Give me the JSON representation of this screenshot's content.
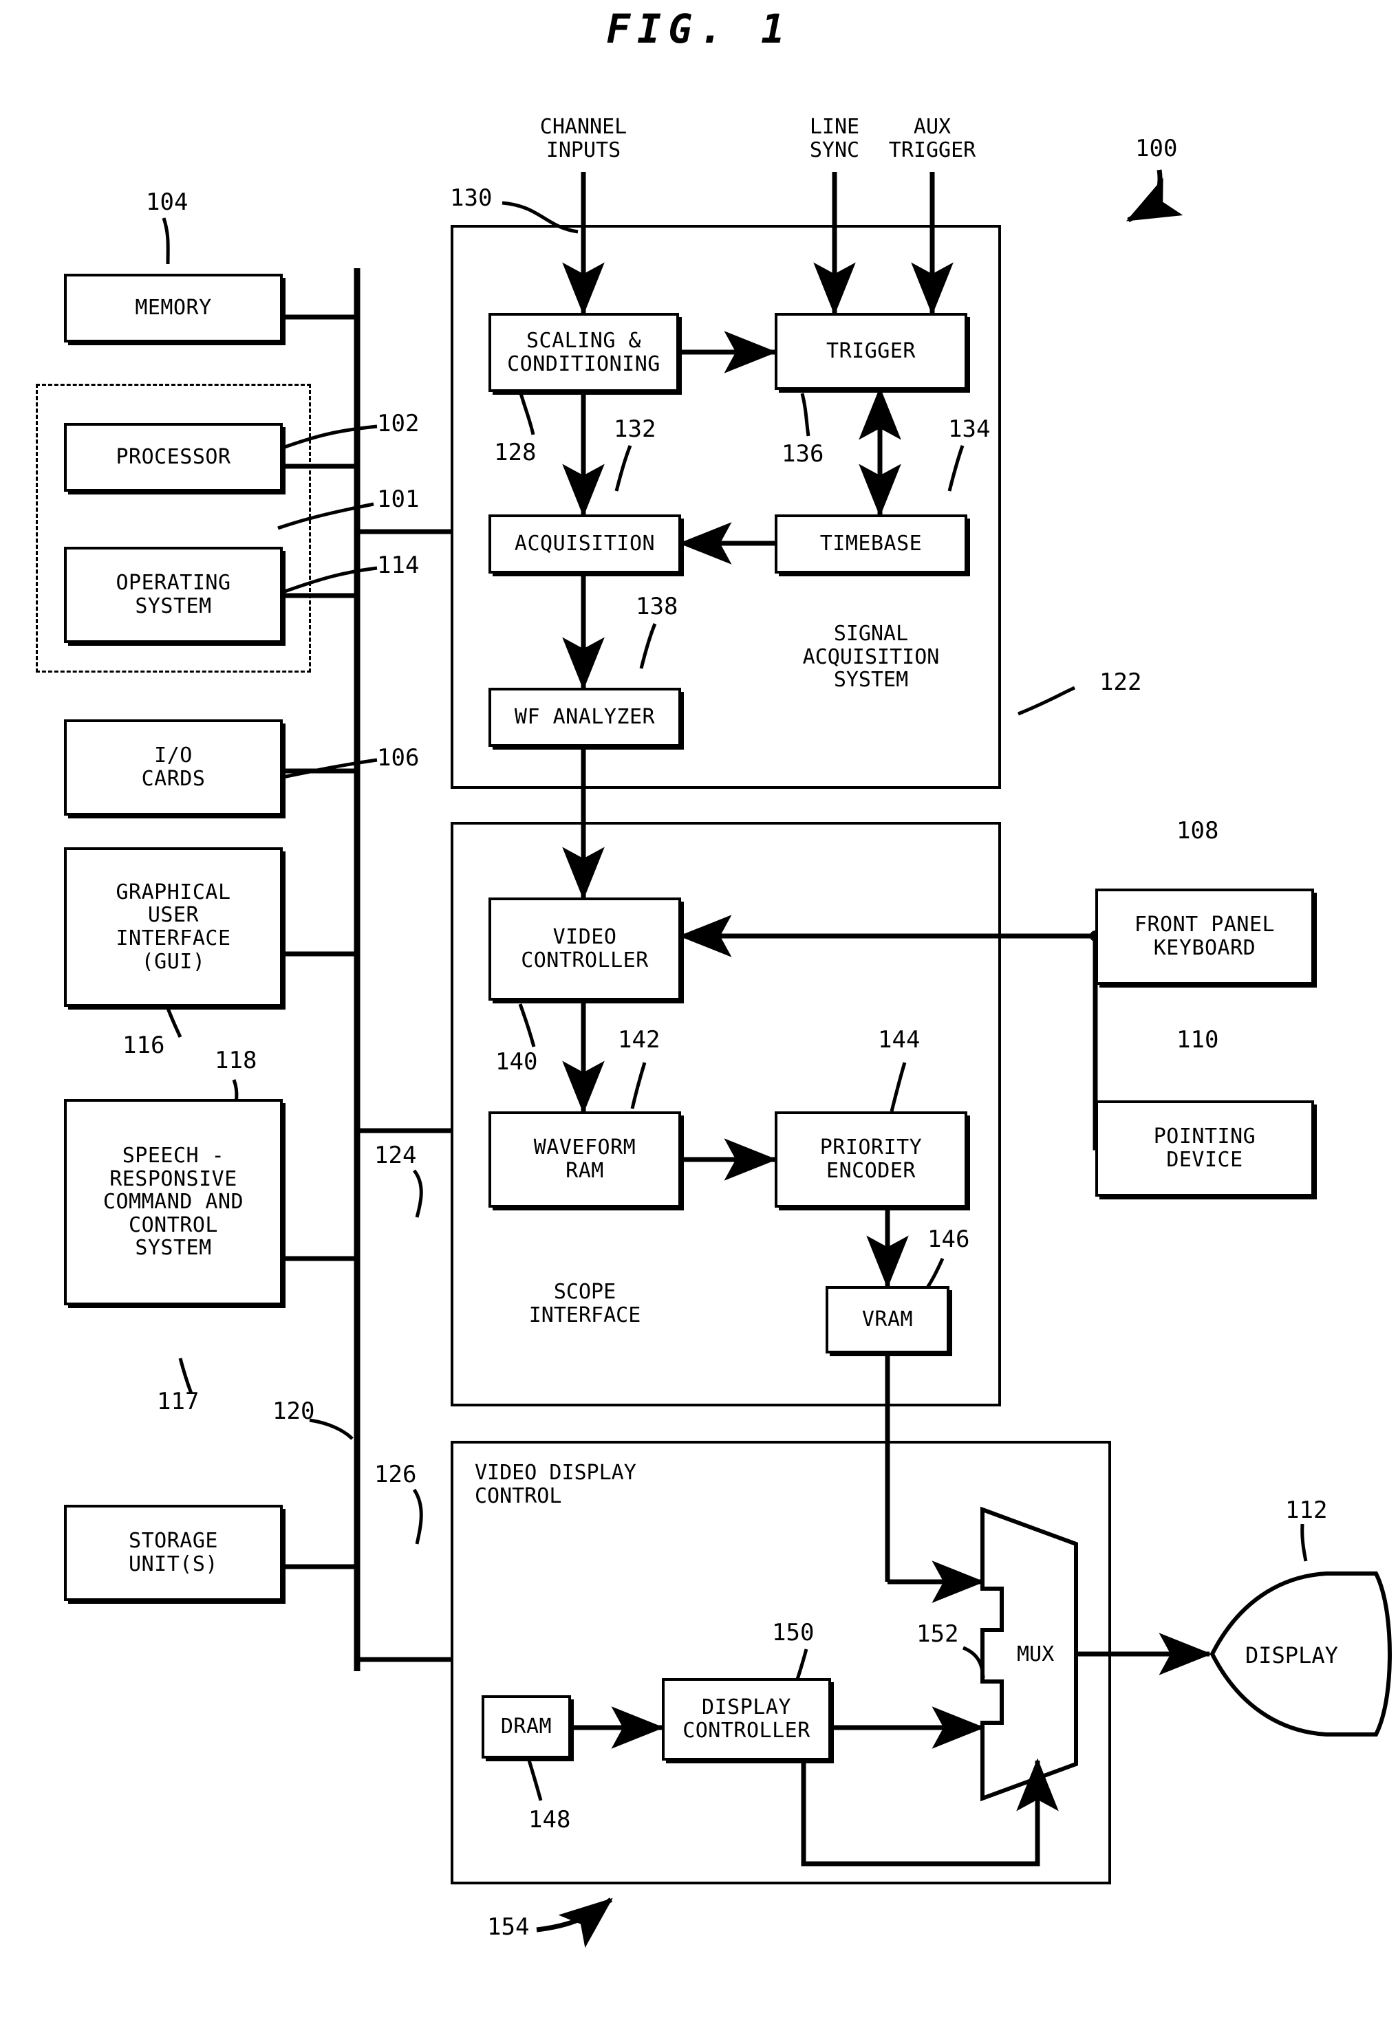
{
  "figure": {
    "title": "FIG. 1",
    "system_ref": "100"
  },
  "ports": [
    {
      "id": "channel-inputs",
      "label": "CHANNEL\nINPUTS",
      "ref": "130"
    },
    {
      "id": "line-sync",
      "label": "LINE\nSYNC",
      "ref": ""
    },
    {
      "id": "aux-trigger",
      "label": "AUX\nTRIGGER",
      "ref": ""
    }
  ],
  "left_column": {
    "blocks": [
      {
        "id": "memory",
        "label": "MEMORY",
        "ref": "104"
      },
      {
        "id": "processor",
        "label": "PROCESSOR",
        "ref": "102"
      },
      {
        "id": "operating-system",
        "label": "OPERATING\nSYSTEM",
        "ref": "114"
      },
      {
        "id": "io-cards",
        "label": "I/O\nCARDS",
        "ref": "106"
      },
      {
        "id": "gui",
        "label": "GRAPHICAL\nUSER\nINTERFACE\n(GUI)",
        "ref": "116"
      },
      {
        "id": "speech-control",
        "label": "SPEECH -\nRESPONSIVE\nCOMMAND AND\nCONTROL\nSYSTEM",
        "ref": "118"
      },
      {
        "id": "storage-units",
        "label": "STORAGE\nUNIT(S)",
        "ref": "117"
      }
    ],
    "computer_group_ref": "101",
    "bus_ref": "120"
  },
  "signal_acquisition": {
    "group_label": "SIGNAL\nACQUISITION\nSYSTEM",
    "group_ref": "122",
    "bus_tap_ref": "101",
    "blocks": [
      {
        "id": "scaling-conditioning",
        "label": "SCALING &\nCONDITIONING",
        "ref": "128"
      },
      {
        "id": "trigger",
        "label": "TRIGGER",
        "ref": "136"
      },
      {
        "id": "acquisition",
        "label": "ACQUISITION",
        "ref": "132"
      },
      {
        "id": "timebase",
        "label": "TIMEBASE",
        "ref": "134"
      },
      {
        "id": "wf-analyzer",
        "label": "WF ANALYZER",
        "ref": "138"
      }
    ]
  },
  "scope_interface": {
    "group_label": "SCOPE\nINTERFACE",
    "group_ref": "124",
    "blocks": [
      {
        "id": "video-controller",
        "label": "VIDEO\nCONTROLLER",
        "ref": "140"
      },
      {
        "id": "waveform-ram",
        "label": "WAVEFORM\nRAM",
        "ref": "142"
      },
      {
        "id": "priority-encoder",
        "label": "PRIORITY\nENCODER",
        "ref": "144"
      },
      {
        "id": "vram",
        "label": "VRAM",
        "ref": "146"
      }
    ]
  },
  "video_display_control": {
    "group_label": "VIDEO DISPLAY\nCONTROL",
    "group_ref": "126",
    "system_ref": "154",
    "blocks": [
      {
        "id": "dram",
        "label": "DRAM",
        "ref": "148"
      },
      {
        "id": "display-controller",
        "label": "DISPLAY\nCONTROLLER",
        "ref": "150"
      },
      {
        "id": "mux",
        "label": "MUX",
        "ref": "152"
      }
    ]
  },
  "peripherals": [
    {
      "id": "front-panel-keyboard",
      "label": "FRONT PANEL\nKEYBOARD",
      "ref": "108"
    },
    {
      "id": "pointing-device",
      "label": "POINTING\nDEVICE",
      "ref": "110"
    },
    {
      "id": "display",
      "label": "DISPLAY",
      "ref": "112"
    }
  ],
  "colors": {
    "ink": "#000000",
    "paper": "#ffffff"
  }
}
